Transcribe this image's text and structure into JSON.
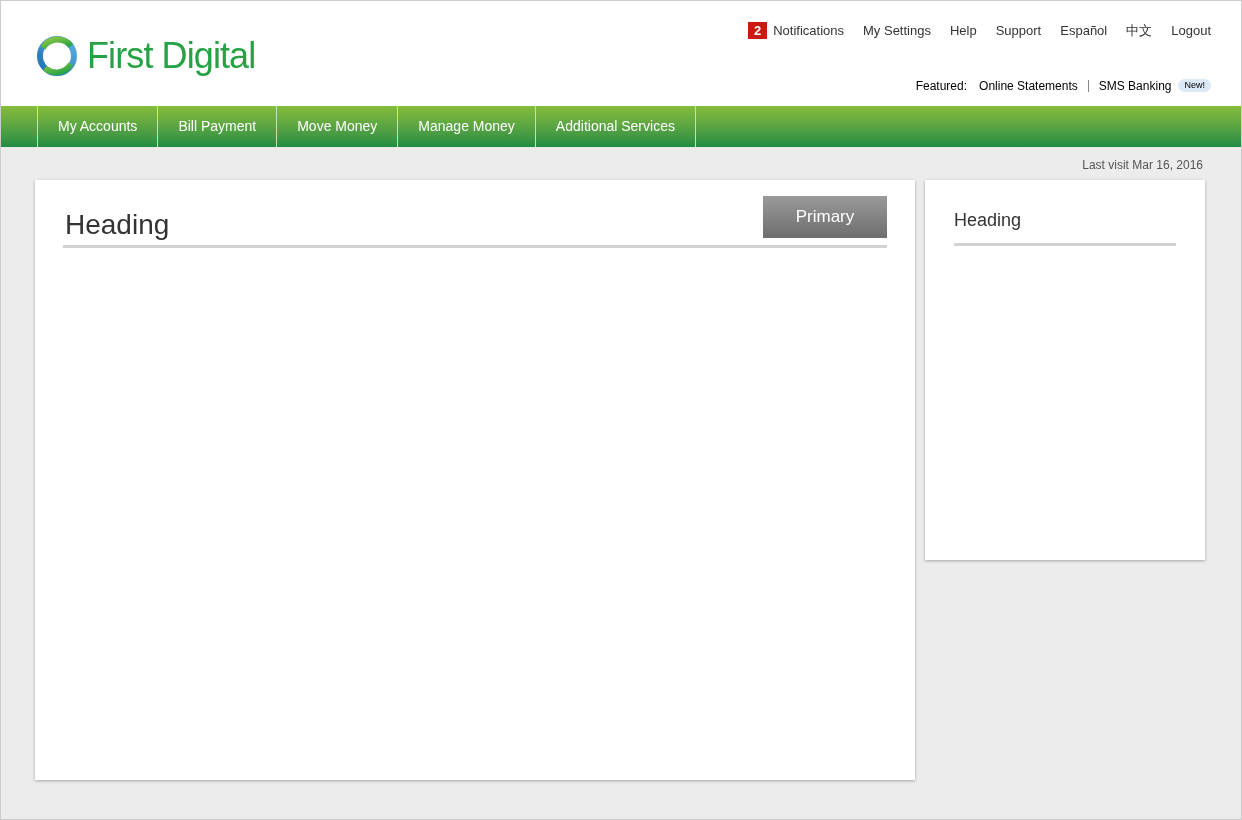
{
  "logo": {
    "text": "First Digital"
  },
  "top_links": {
    "notifications": {
      "count": "2",
      "label": "Notifications"
    },
    "items": [
      "My Settings",
      "Help",
      "Support",
      "Español",
      "中文",
      "Logout"
    ]
  },
  "featured": {
    "label": "Featured:",
    "links": [
      "Online Statements",
      "SMS Banking"
    ],
    "badge": "New!"
  },
  "nav": [
    "My Accounts",
    "Bill Payment",
    "Move Money",
    "Manage Money",
    "Additional Services"
  ],
  "last_visit": "Last visit Mar 16, 2016",
  "main_panel": {
    "heading": "Heading",
    "button": "Primary"
  },
  "side_panel": {
    "heading": "Heading"
  }
}
